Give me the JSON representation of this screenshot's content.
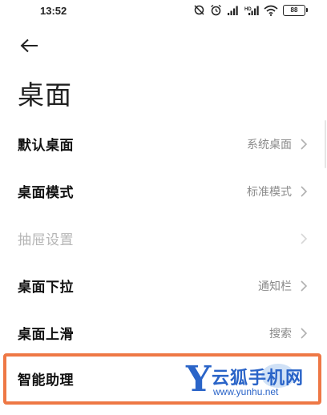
{
  "status_bar": {
    "time": "13:52",
    "battery": "88",
    "icons": [
      "do-not-disturb-icon",
      "alarm-icon",
      "signal-icon",
      "signal-2-icon",
      "wifi-icon",
      "battery-icon"
    ]
  },
  "header": {
    "back_icon": "back-arrow-icon",
    "title": "桌面"
  },
  "settings": [
    {
      "label": "默认桌面",
      "value": "系统桌面",
      "enabled": true
    },
    {
      "label": "桌面模式",
      "value": "标准模式",
      "enabled": true
    },
    {
      "label": "抽屉设置",
      "value": "",
      "enabled": false
    },
    {
      "label": "桌面下拉",
      "value": "通知栏",
      "enabled": true
    },
    {
      "label": "桌面上滑",
      "value": "搜索",
      "enabled": true
    },
    {
      "label": "智能助理",
      "value": "",
      "enabled": true
    }
  ],
  "highlight_color": "#ee7845",
  "watermark": {
    "letter": "Y",
    "text": "云狐手机网",
    "url": "www.yunhu.net",
    "color": "#2a64c8"
  }
}
